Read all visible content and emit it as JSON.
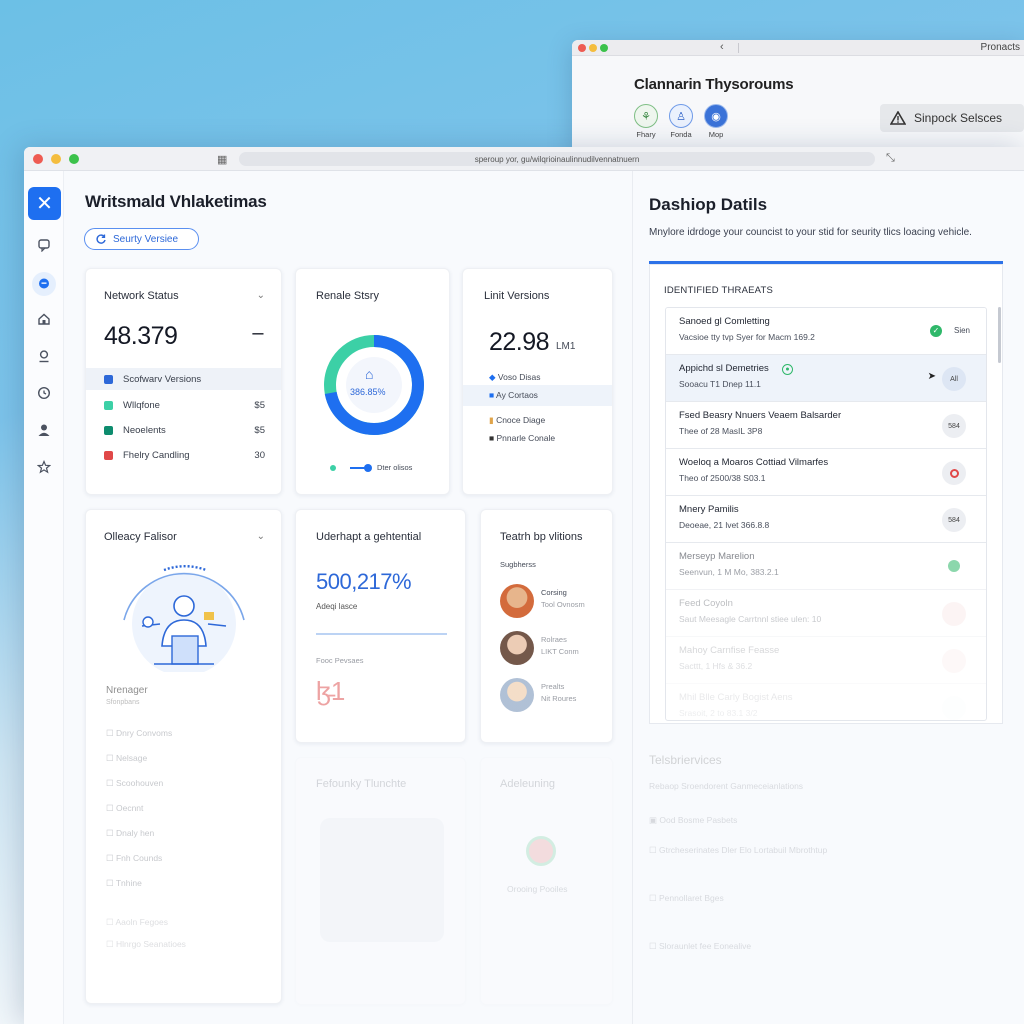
{
  "colors": {
    "accent": "#1e6ff0",
    "green": "#2fb86a",
    "red": "#e04848",
    "teal": "#3cd0a6"
  },
  "back_window": {
    "nav_icon": "chevron-left",
    "url": "Pronacts",
    "title": "Clannarin Thysoroums",
    "avatars": [
      {
        "label": "Fhary"
      },
      {
        "label": "Fonda"
      },
      {
        "label": "Mop"
      }
    ],
    "badge": "Sinpock Selsces"
  },
  "main_window": {
    "url": "speroup yor, gu/wilqrioinaulinnudilvennatnuern",
    "sidebar": [
      "close-icon",
      "chat-icon",
      "comment-icon",
      "home-icon",
      "person-circle-icon",
      "clock-icon",
      "user-icon",
      "star-icon"
    ],
    "title": "Writsmald Vhlaketimas",
    "security_pill": "Seurty Versiee",
    "network": {
      "title": "Network Status",
      "value": "48.379",
      "dash": "–",
      "items": [
        {
          "label": "Scofwarv Versions",
          "value": ""
        },
        {
          "label": "Wllqfone",
          "value": "$5"
        },
        {
          "label": "Neoelents",
          "value": "$5"
        },
        {
          "label": "Fhelry Candling",
          "value": "30"
        }
      ]
    },
    "renale": {
      "title": "Renale Stsry",
      "center": "386.85%",
      "legend": "Dter olisos",
      "percent": 72
    },
    "linit": {
      "title": "Linit Versions",
      "value": "22.98",
      "unit": "LM1",
      "items": [
        "Voso Disas",
        "Ay Cortaos",
        "Cnoce Diage",
        "Pnnarle Conale"
      ]
    },
    "policy": {
      "title": "Olleacy Falisor",
      "list_head": "Nrenager",
      "list_sub": "Sfonpbans",
      "items": [
        "Dnry Convoms",
        "Nelsage",
        "Scoohouven",
        "Oecnnt",
        "Dnaly hen",
        "Fnh Counds",
        "Tnhine"
      ],
      "footer_items": [
        "Aaoln Fegoes",
        "Hlnrgo Seanatioes"
      ]
    },
    "potential": {
      "title": "Uderhapt a gehtential",
      "value": "500,217%",
      "sub": "Adeqi lasce",
      "label": "Fooc Pevsaes",
      "mark": "ɮ̵1"
    },
    "teams": {
      "title": "Teatrh bp vlitions",
      "sub": "Sugbherss",
      "people": [
        {
          "name": "Corsing",
          "role": "Tool Ovnosm"
        },
        {
          "name": "Rolraes",
          "role": "LIKT Conm"
        },
        {
          "name": "Prealts",
          "role": "Nit Roures"
        }
      ]
    },
    "faint_cards": [
      {
        "title": "Fefounky Tlunchte"
      },
      {
        "title": "Adeleuning",
        "sub": "Orooing Pooiles"
      }
    ],
    "details": {
      "title": "Dashiop Datils",
      "desc": "Mnylore idrdoge your councist to your stid for seurity tlics loacing vehicle.",
      "threats_heading": "IDENTIFIED THRAEATS",
      "threats": [
        {
          "name": "Sanoed gl Comletting",
          "sub": "Vacsioe tty tvp Syer for Macm 169.2",
          "badge": "Sien",
          "status": "green"
        },
        {
          "name": "Appichd sl Demetries",
          "sub": "Sooacu T1 Dnep 11.1",
          "badge": "All",
          "status": "green"
        },
        {
          "name": "Fsed Beasry Nnuers Veaem Balsarder",
          "sub": "Thee of 28 MasIL 3P8",
          "badge": "584",
          "status": "none"
        },
        {
          "name": "Woeloq a Moaros Cottiad Vilmarfes",
          "sub": "Theo of 2500/38 S03.1",
          "badge": "",
          "status": "red"
        },
        {
          "name": "Mnery Pamilis",
          "sub": "Deoeae, 21 lvet 366.8.8",
          "badge": "584",
          "status": "none"
        },
        {
          "name": "Merseyp Marelion",
          "sub": "Seenvun, 1 M Mo, 383.2.1",
          "badge": "",
          "status": "green"
        },
        {
          "name": "Feed Coyoln",
          "sub": "Saut Meesagle Carrtnnl stiee ulen: 10",
          "badge": "",
          "status": "red"
        },
        {
          "name": "Mahoy Carnfise Feasse",
          "sub": "Sacttt, 1 Hfs & 36.2",
          "badge": "",
          "status": "red"
        },
        {
          "name": "Mhil Blle Carly Bogist Aens",
          "sub": "Srasoit, 2 to 83.1 3/2",
          "badge": "",
          "status": "none"
        }
      ],
      "services_title": "Telsbriervices",
      "services_sub": "Rebaop Sroendorent Ganmeceianlations",
      "services_items": [
        "Ood Bosme Pasbets",
        "Gtrcheserinates Dler Elo Lortabuil Mbrothtup",
        "Pennollaret Bges",
        "Sloraunlet fee Eonealive"
      ]
    }
  }
}
